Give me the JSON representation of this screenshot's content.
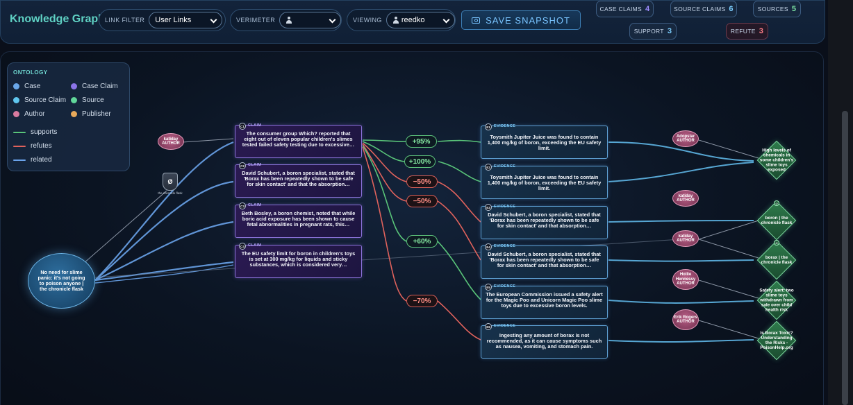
{
  "header": {
    "title": "Knowledge Graph",
    "link_filter_label": "LINK FILTER",
    "link_filter_value": "User Links",
    "verimeter_label": "VERIMETER",
    "verimeter_value": "",
    "viewing_label": "VIEWING",
    "viewing_value": "reedko",
    "save_label": "SAVE SNAPSHOT",
    "stats": [
      {
        "label": "CASE CLAIMS",
        "value": "4"
      },
      {
        "label": "SOURCE CLAIMS",
        "value": "6"
      },
      {
        "label": "SOURCES",
        "value": "5"
      },
      {
        "label": "SUPPORT",
        "value": "3"
      },
      {
        "label": "REFUTE",
        "value": "3"
      }
    ]
  },
  "colors": {
    "case": "#6aa7ea",
    "case_claim": "#8b74e8",
    "source_claim": "#5fc6ee",
    "source": "#61d79a",
    "author": "#d87ba0",
    "publisher": "#e8a95a",
    "supports": "#59c479",
    "refutes": "#e0625c",
    "related": "#6aa3ea"
  },
  "legend": {
    "title": "ONTOLOGY",
    "case": "Case",
    "case_claim": "Case Claim",
    "source_claim": "Source Claim",
    "source": "Source",
    "author": "Author",
    "publisher": "Publisher",
    "supports": "supports",
    "refutes": "refutes",
    "related": "related"
  },
  "case_node": {
    "text": "No need for slime panic: it's not going to poison anyone | the chronicle flask"
  },
  "publisher_node": {
    "glyph": "Ø",
    "label": "the chronicle flask"
  },
  "claims": [
    {
      "badge": "C1",
      "kind": "CLAIM",
      "text": "The consumer group Which? reported that eight out of eleven popular children's slimes tested failed safety testing due to excessive…"
    },
    {
      "badge": "C2",
      "kind": "CLAIM",
      "text": "David Schubert, a boron specialist, stated that 'Borax has been repeatedly shown to be safe for skin contact' and that the absorption…"
    },
    {
      "badge": "C3",
      "kind": "CLAIM",
      "text": "Beth Bosley, a boron chemist, noted that while boric acid exposure has been shown to cause fetal abnormalities in pregnant rats, this…"
    },
    {
      "badge": "C4",
      "kind": "CLAIM",
      "text": "The EU safety limit for boron in children's toys is set at 300 mg/kg for liquids and sticky substances, which is considered very…"
    }
  ],
  "evidence": [
    {
      "badge": "E1",
      "kind": "EVIDENCE",
      "text": "Toysmith Jupiter Juice was found to contain 1,400 mg/kg of boron, exceeding the EU safety limit."
    },
    {
      "badge": "E2",
      "kind": "EVIDENCE",
      "text": "Toysmith Jupiter Juice was found to contain 1,400 mg/kg of boron, exceeding the EU safety limit."
    },
    {
      "badge": "E3",
      "kind": "EVIDENCE",
      "text": "David Schubert, a boron specialist, stated that 'Borax has been repeatedly shown to be safe for skin contact' and that absorption…"
    },
    {
      "badge": "E4",
      "kind": "EVIDENCE",
      "text": "David Schubert, a boron specialist, stated that 'Borax has been repeatedly shown to be safe for skin contact' and that absorption…"
    },
    {
      "badge": "E5",
      "kind": "EVIDENCE",
      "text": "The European Commission issued a safety alert for the Magic Poo and Unicorn Magic Poo slime toys due to excessive boron levels."
    },
    {
      "badge": "E6",
      "kind": "EVIDENCE",
      "text": "Ingesting any amount of borax is not recommended, as it can cause symptoms such as nausea, vomiting, and stomach pain."
    }
  ],
  "links": [
    {
      "value": "+95%",
      "polarity": "support"
    },
    {
      "value": "+100%",
      "polarity": "support"
    },
    {
      "value": "−50%",
      "polarity": "refute"
    },
    {
      "value": "−50%",
      "polarity": "refute"
    },
    {
      "value": "+60%",
      "polarity": "support"
    },
    {
      "value": "−70%",
      "polarity": "refute"
    }
  ],
  "authors": [
    {
      "name": "katiday",
      "role": "AUTHOR"
    },
    {
      "name": "Adopstar",
      "role": "AUTHOR"
    },
    {
      "name": "katiday",
      "role": "AUTHOR"
    },
    {
      "name": "katiday",
      "role": "AUTHOR"
    },
    {
      "name": "Hollie Hennessy",
      "role": "AUTHOR"
    },
    {
      "name": "Erik Rogers",
      "role": "AUTHOR"
    }
  ],
  "sources": [
    {
      "glyph": "H",
      "text": "High levels of chemicals in some children's slime toys exposed"
    },
    {
      "glyph": "Ø",
      "text": "boron | the chronicle flask"
    },
    {
      "glyph": "Ø",
      "text": "borax | the chronicle flask"
    },
    {
      "glyph": "S",
      "text": "Safety alert: two slime toys withdrawn from sale over child health risk"
    },
    {
      "glyph": "P",
      "text": "Is Borax Toxic? Understanding the Risks - PoisonHelp.org"
    }
  ]
}
